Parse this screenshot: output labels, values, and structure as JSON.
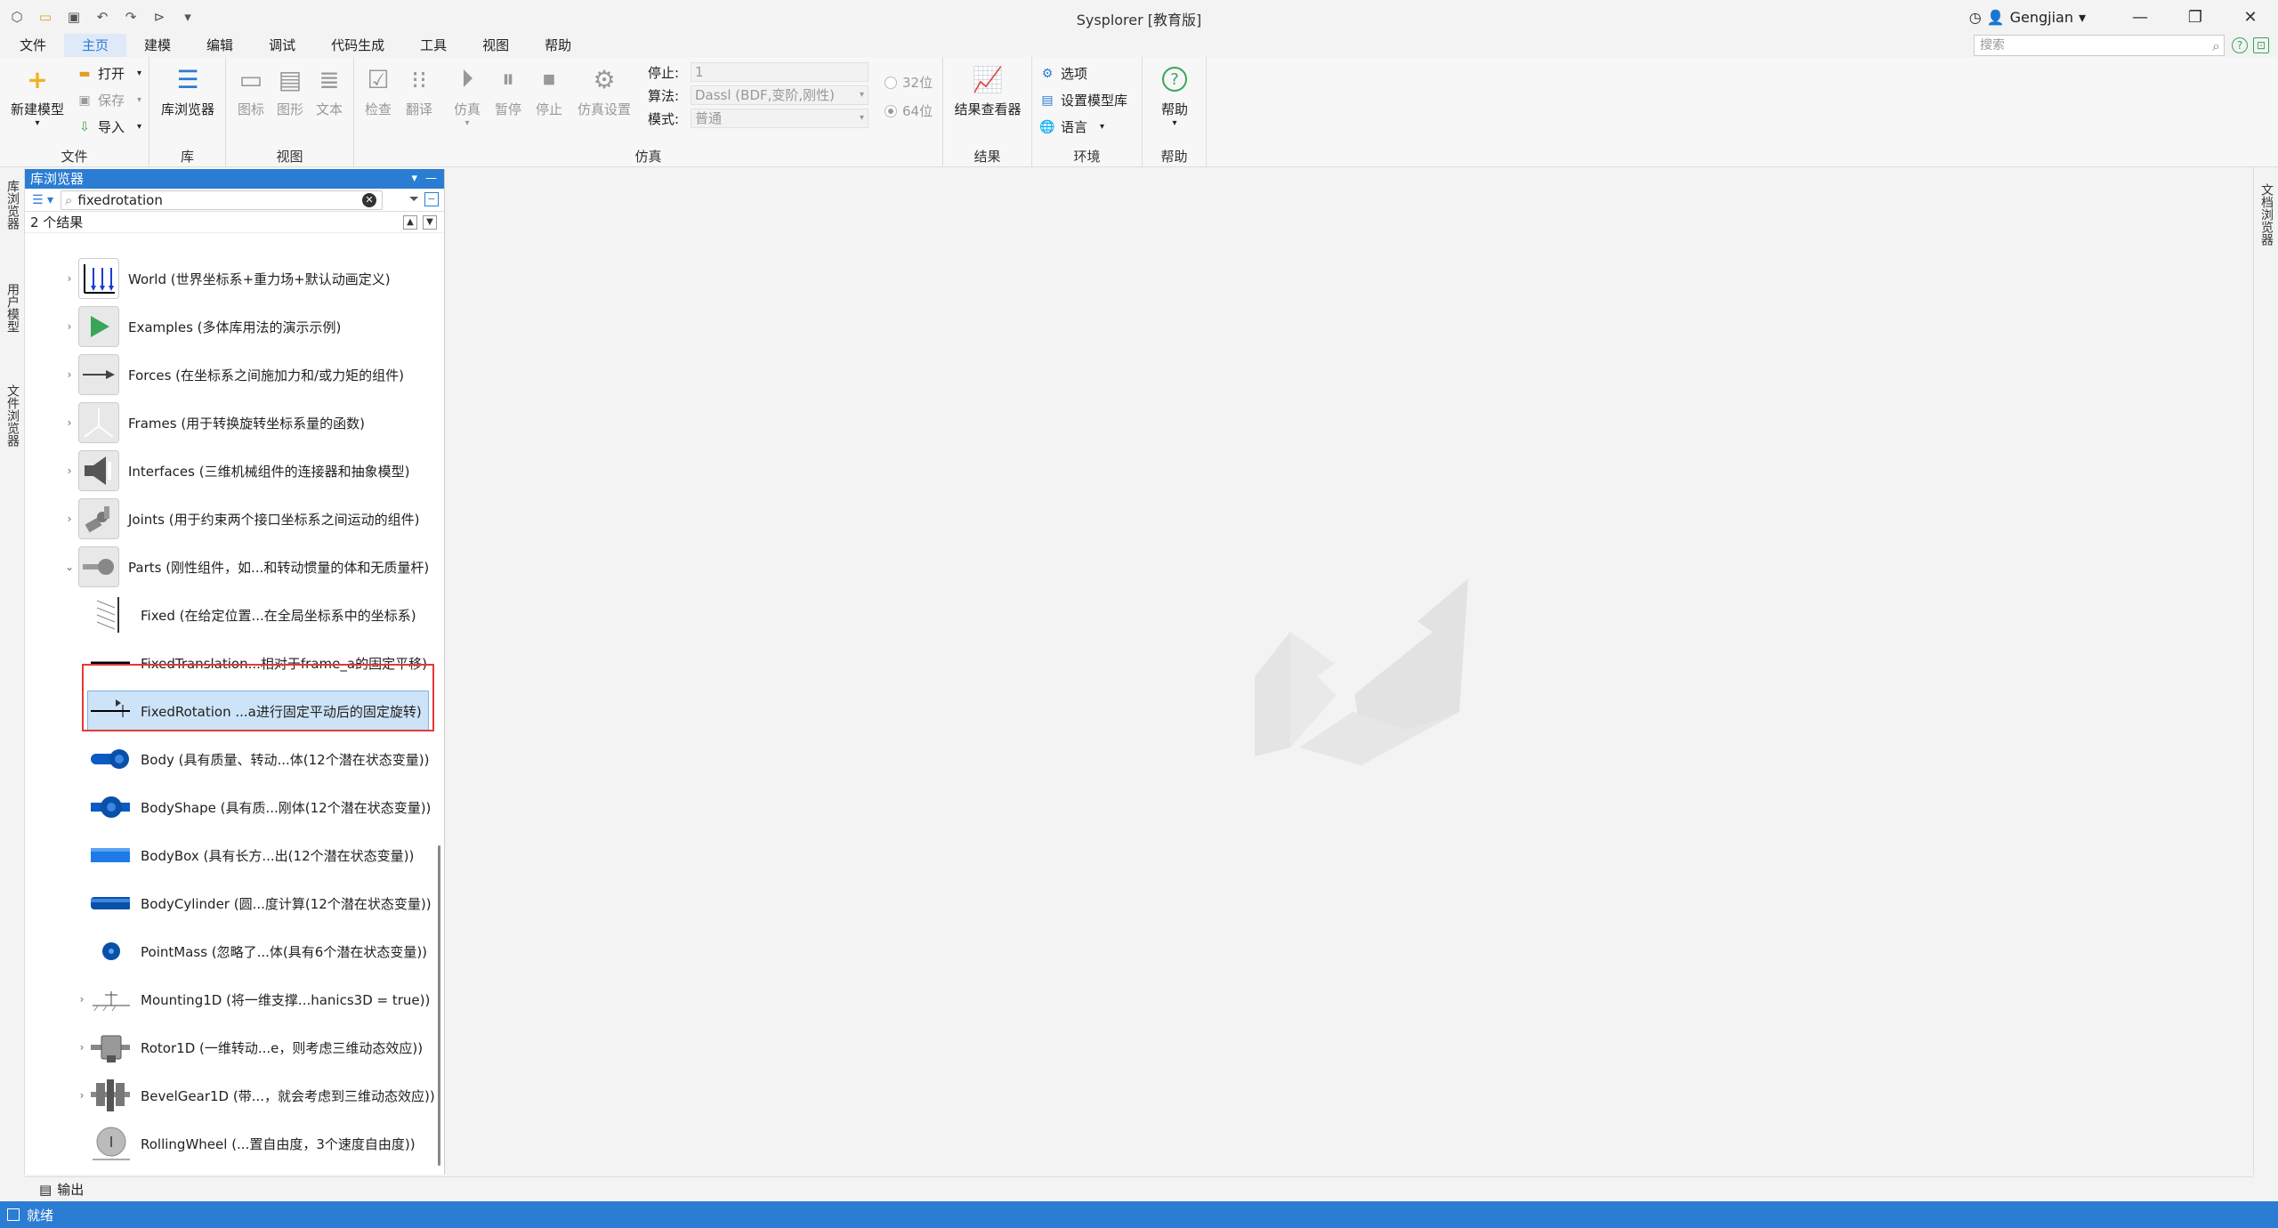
{
  "window": {
    "title": "Sysplorer [教育版]",
    "user": "Gengjian"
  },
  "menu": {
    "items": [
      "文件",
      "主页",
      "建模",
      "编辑",
      "调试",
      "代码生成",
      "工具",
      "视图",
      "帮助"
    ],
    "active_index": 1
  },
  "search_top": {
    "placeholder": "搜索"
  },
  "ribbon": {
    "file": {
      "group_label": "文件",
      "new_model": "新建模型",
      "open": "打开",
      "save": "保存",
      "import": "导入"
    },
    "library": {
      "group_label": "库",
      "lib_browser": "库浏览器"
    },
    "view": {
      "group_label": "视图",
      "icon": "图标",
      "diagram": "图形",
      "text": "文本"
    },
    "sim": {
      "group_label": "仿真",
      "check": "检查",
      "translate": "翻译",
      "simulate": "仿真",
      "pause": "暂停",
      "stop": "停止",
      "settings": "仿真设置",
      "stop_time_label": "停止:",
      "stop_time_value": "1",
      "algorithm_label": "算法:",
      "algorithm_value": "Dassl (BDF,变阶,刚性)",
      "mode_label": "模式:",
      "mode_value": "普通",
      "bit32": "32位",
      "bit64": "64位"
    },
    "results": {
      "group_label": "结果",
      "viewer": "结果查看器"
    },
    "env": {
      "group_label": "环境",
      "options": "选项",
      "set_lib": "设置模型库",
      "language": "语言"
    },
    "help": {
      "group_label": "帮助",
      "help": "帮助"
    }
  },
  "left_tabs": [
    "库浏览器",
    "用户模型",
    "文件浏览器"
  ],
  "right_tabs": [
    "文档浏览器"
  ],
  "panel": {
    "title": "库浏览器",
    "search_value": "fixedrotation",
    "result_count": "2 个结果",
    "items": [
      {
        "label": "World (世界坐标系+重力场+默认动画定义)",
        "icon": "world-icon"
      },
      {
        "label": "Examples (多体库用法的演示示例)",
        "icon": "examples-icon"
      },
      {
        "label": "Forces (在坐标系之间施加力和/或力矩的组件)",
        "icon": "forces-icon"
      },
      {
        "label": "Frames (用于转换旋转坐标系量的函数)",
        "icon": "frames-icon"
      },
      {
        "label": "Interfaces (三维机械组件的连接器和抽象模型)",
        "icon": "interfaces-icon"
      },
      {
        "label": "Joints (用于约束两个接口坐标系之间运动的组件)",
        "icon": "joints-icon"
      },
      {
        "label": "Parts (刚性组件，如...和转动惯量的体和无质量杆)",
        "icon": "parts-icon"
      },
      {
        "label": "Fixed (在给定位置...在全局坐标系中的坐标系)",
        "icon": "fixed-icon"
      },
      {
        "label": "FixedTranslation...相对于frame_a的固定平移)",
        "icon": "fixed-translation-icon"
      },
      {
        "label": "FixedRotation ...a进行固定平动后的固定旋转)",
        "icon": "fixed-rotation-icon"
      },
      {
        "label": "Body (具有质量、转动...体(12个潜在状态变量))",
        "icon": "body-icon"
      },
      {
        "label": "BodyShape (具有质...刚体(12个潜在状态变量))",
        "icon": "body-shape-icon"
      },
      {
        "label": "BodyBox (具有长方...出(12个潜在状态变量))",
        "icon": "body-box-icon"
      },
      {
        "label": "BodyCylinder (圆...度计算(12个潜在状态变量))",
        "icon": "body-cylinder-icon"
      },
      {
        "label": "PointMass (忽略了...体(具有6个潜在状态变量))",
        "icon": "point-mass-icon"
      },
      {
        "label": "Mounting1D (将一维支撑...hanics3D = true))",
        "icon": "mounting1d-icon"
      },
      {
        "label": "Rotor1D (一维转动...e，则考虑三维动态效应))",
        "icon": "rotor1d-icon"
      },
      {
        "label": "BevelGear1D (带...，就会考虑到三维动态效应))",
        "icon": "bevelgear1d-icon"
      },
      {
        "label": "RollingWheel (...置自由度，3个速度自由度))",
        "icon": "rolling-wheel-icon"
      }
    ]
  },
  "output_label": "输出",
  "status_text": "就绪"
}
